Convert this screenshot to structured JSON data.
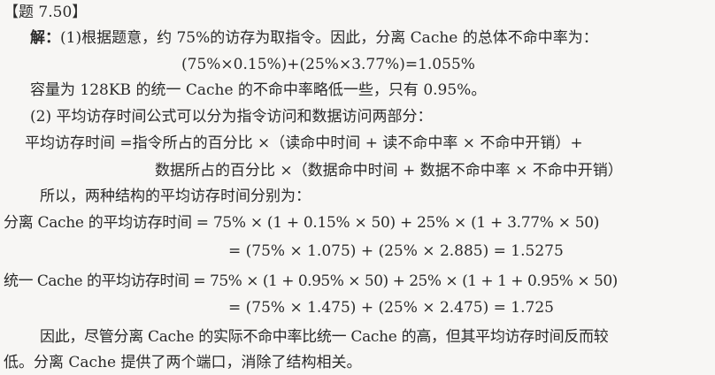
{
  "problem_label": "【题 7.50】",
  "solution": {
    "prefix": "解：",
    "part1_intro": "(1)根据题意，约 75%的访存为取指令。因此，分离 Cache 的总体不命中率为：",
    "part1_formula": "(75%×0.15%)+(25%×3.77%)=1.055%",
    "part1_unified": "容量为 128KB 的统一 Cache 的不命中率略低一些，只有 0.95%。",
    "part2_intro": "(2) 平均访存时间公式可以分为指令访问和数据访问两部分：",
    "formula_line1": "平均访存时间 =指令所占的百分比 ×（读命中时间 + 读不命中率 × 不命中开销）+",
    "formula_line2": "数据所占的百分比 ×（数据命中时间 + 数据不命中率 × 不命中开销）",
    "so_line": "所以，两种结构的平均访存时间分别为：",
    "split_line1": "分离 Cache 的平均访存时间 = 75% × (1 + 0.15% × 50) + 25% × (1 + 3.77% × 50)",
    "split_line2": "= (75% × 1.075) + (25% × 2.885) = 1.5275",
    "unified_line1": "统一 Cache 的平均访存时间 = 75% × (1 + 0.95% × 50) + 25% × (1 + 1 + 0.95% × 50)",
    "unified_line2": "= (75% × 1.475) + (25% × 2.475) = 1.725",
    "conclusion_line1": "因此，尽管分离 Cache 的实际不命中率比统一 Cache 的高，但其平均访存时间反而较",
    "conclusion_line2": "低。分离 Cache 提供了两个端口，消除了结构相关。"
  }
}
